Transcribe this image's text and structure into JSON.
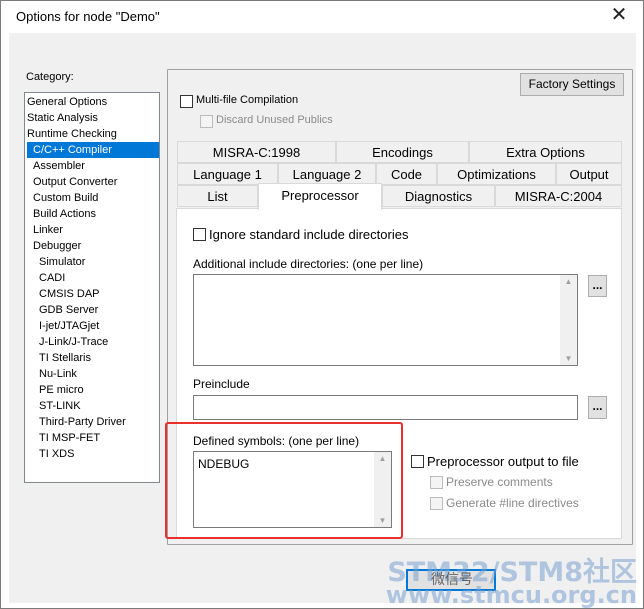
{
  "window": {
    "title": "Options for node \"Demo\"",
    "close_glyph": "✕"
  },
  "category": {
    "label": "Category:",
    "items": [
      {
        "label": "General Options"
      },
      {
        "label": "Static Analysis"
      },
      {
        "label": "Runtime Checking"
      },
      {
        "label": "C/C++ Compiler",
        "selected": true
      },
      {
        "label": "Assembler"
      },
      {
        "label": "Output Converter"
      },
      {
        "label": "Custom Build"
      },
      {
        "label": "Build Actions"
      },
      {
        "label": "Linker"
      },
      {
        "label": "Debugger"
      },
      {
        "label": "Simulator"
      },
      {
        "label": "CADI"
      },
      {
        "label": "CMSIS DAP"
      },
      {
        "label": "GDB Server"
      },
      {
        "label": "I-jet/JTAGjet"
      },
      {
        "label": "J-Link/J-Trace"
      },
      {
        "label": "TI Stellaris"
      },
      {
        "label": "Nu-Link"
      },
      {
        "label": "PE micro"
      },
      {
        "label": "ST-LINK"
      },
      {
        "label": "Third-Party Driver"
      },
      {
        "label": "TI MSP-FET"
      },
      {
        "label": "TI XDS"
      }
    ]
  },
  "factory_settings_label": "Factory Settings",
  "multi_file": {
    "label": "Multi-file Compilation",
    "checked": false
  },
  "discard_publics": {
    "label": "Discard Unused Publics",
    "checked": false,
    "disabled": true
  },
  "tabs": {
    "row1": [
      "MISRA-C:1998",
      "Encodings",
      "Extra Options"
    ],
    "row2": [
      "Language 1",
      "Language 2",
      "Code",
      "Optimizations",
      "Output"
    ],
    "row3": [
      "List",
      "Preprocessor",
      "Diagnostics",
      "MISRA-C:2004"
    ],
    "active": "Preprocessor"
  },
  "preprocessor": {
    "ignore_std_label": "Ignore standard include directories",
    "additional_label": "Additional include directories: (one per line)",
    "additional_value": "",
    "browse_label": "...",
    "preinclude_label": "Preinclude",
    "preinclude_value": "",
    "defined_label": "Defined symbols: (one per line)",
    "defined_value": "NDEBUG",
    "preproc_output_label": "Preprocessor output to file",
    "preserve_comments_label": "Preserve comments",
    "generate_line_label": "Generate #line directives"
  },
  "watermark": {
    "line1": "STM32/STM8社区",
    "line2": "www.stmcu.org.cn",
    "wechat": "微信号"
  },
  "colors": {
    "selection": "#0078d7",
    "highlight_box": "#e8312f"
  }
}
